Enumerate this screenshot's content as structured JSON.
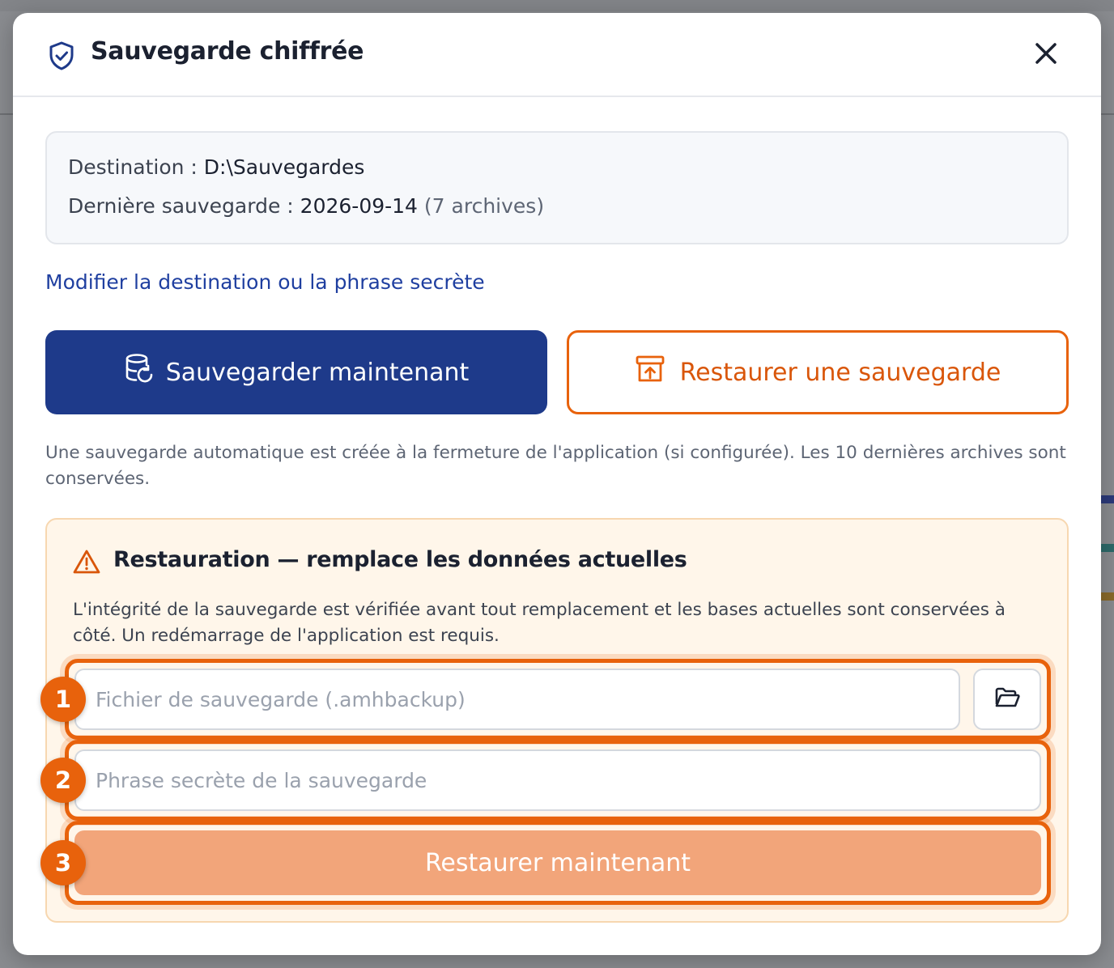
{
  "modal": {
    "title": "Sauvegarde chiffrée",
    "close_icon": "close-icon",
    "header_icon": "shield-check-icon"
  },
  "info": {
    "destination_label": "Destination : ",
    "destination_value": "D:\\Sauvegardes",
    "last_backup_label": "Dernière sauvegarde : ",
    "last_backup_value": "2026-09-14",
    "archives_count": "(7 archives)"
  },
  "edit_link": "Modifier la destination ou la phrase secrète",
  "actions": {
    "backup_now_label": "Sauvegarder maintenant",
    "backup_now_icon": "database-refresh-icon",
    "restore_label": "Restaurer une sauvegarde",
    "restore_icon": "archive-upload-icon"
  },
  "help_text": "Une sauvegarde automatique est créée à la fermeture de l'application (si configurée). Les 10 dernières archives sont conservées.",
  "restore_panel": {
    "title": "Restauration — remplace les données actuelles",
    "warning_icon": "warning-triangle-icon",
    "description": "L'intégrité de la sauvegarde est vérifiée avant tout remplacement et les bases actuelles sont conservées à côté. Un redémarrage de l'application est requis.",
    "file_placeholder": "Fichier de sauvegarde (.amhbackup)",
    "browse_icon": "folder-open-icon",
    "passphrase_placeholder": "Phrase secrète de la sauvegarde",
    "restore_now_label": "Restaurer maintenant"
  },
  "steps": [
    "1",
    "2",
    "3"
  ],
  "colors": {
    "primary": "#1e3a8a",
    "accent": "#e8620c",
    "restore_button_disabled": "#f2a57a",
    "warning_bg": "#fff6ea"
  }
}
